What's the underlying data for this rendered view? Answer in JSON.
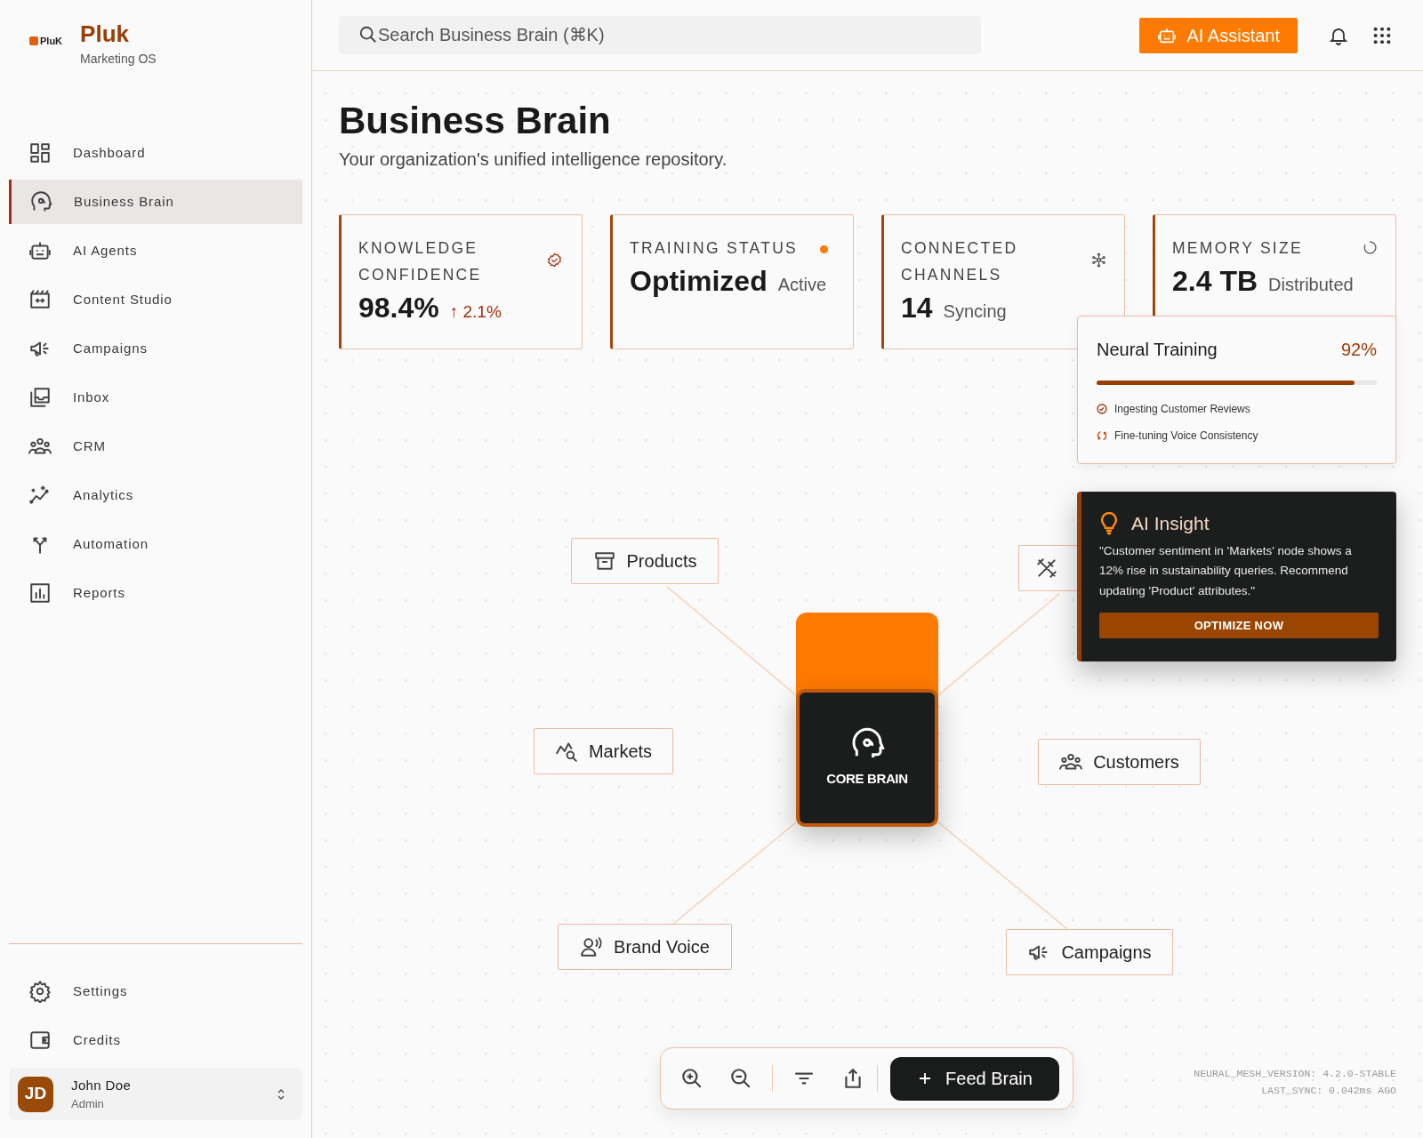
{
  "brand": {
    "logo_text": "PluK",
    "name": "Pluk",
    "tagline": "Marketing OS"
  },
  "sidebar": {
    "items": [
      {
        "label": "Dashboard",
        "selected": false
      },
      {
        "label": "Business Brain",
        "selected": true
      },
      {
        "label": "AI Agents",
        "selected": false
      },
      {
        "label": "Content Studio",
        "selected": false
      },
      {
        "label": "Campaigns",
        "selected": false
      },
      {
        "label": "Inbox",
        "selected": false
      },
      {
        "label": "CRM",
        "selected": false
      },
      {
        "label": "Analytics",
        "selected": false
      },
      {
        "label": "Automation",
        "selected": false
      },
      {
        "label": "Reports",
        "selected": false
      }
    ],
    "footer_items": [
      {
        "label": "Settings"
      },
      {
        "label": "Credits"
      }
    ],
    "user": {
      "initials": "JD",
      "name": "John Doe",
      "role": "Admin"
    }
  },
  "search": {
    "placeholder": "Search Business Brain (⌘K)"
  },
  "header": {
    "assistant_button": "AI Assistant"
  },
  "page": {
    "title": "Business Brain",
    "subtitle": "Your organization's unified intelligence repository."
  },
  "stats": [
    {
      "label": "KNOWLEDGE CONFIDENCE",
      "value": "98.4%",
      "note": "↑ 2.1%",
      "kind": "trend"
    },
    {
      "label": "TRAINING STATUS",
      "value": "Optimized",
      "note": "Active",
      "kind": "plain"
    },
    {
      "label": "CONNECTED CHANNELS",
      "value": "14",
      "note": "Syncing",
      "kind": "plain"
    },
    {
      "label": "MEMORY SIZE",
      "value": "2.4 TB",
      "note": "Distributed",
      "kind": "plain"
    }
  ],
  "training": {
    "title": "Neural Training",
    "percent": "92%",
    "level": 0.92,
    "tasks": [
      {
        "label": "Ingesting Customer Reviews",
        "done": true
      },
      {
        "label": "Fine-tuning Voice Consistency",
        "done": false
      }
    ]
  },
  "insight": {
    "title": "AI Insight",
    "text": "\"Customer sentiment in 'Markets' node shows a 12% rise in sustainability queries. Recommend updating 'Product' attributes.\"",
    "button": "OPTIMIZE NOW"
  },
  "graph": {
    "core": {
      "label": "CORE BRAIN"
    },
    "nodes": [
      {
        "label": "Products"
      },
      {
        "label": "Markets"
      },
      {
        "label": "Customers"
      },
      {
        "label": "Brand Voice"
      },
      {
        "label": "Campaigns"
      }
    ]
  },
  "toolbar": {
    "feed_button": "Feed Brain"
  },
  "version": [
    "NEURAL_MESH_VERSION: 4.2.0-STABLE",
    "LAST_SYNC: 0.042ms AGO"
  ]
}
